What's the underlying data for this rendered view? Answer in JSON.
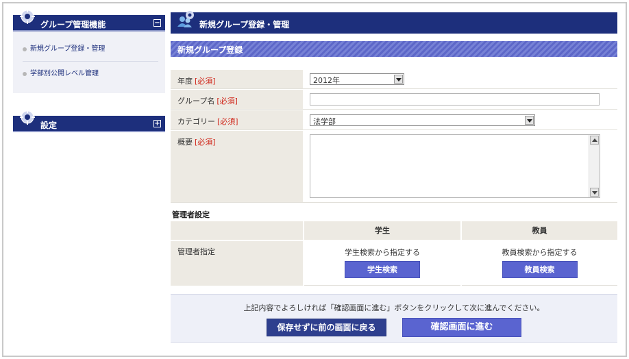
{
  "sidebar": {
    "sections": [
      {
        "title": "グループ管理機能",
        "toggle": "⊟",
        "items": [
          {
            "label": "新規グループ登録・管理"
          },
          {
            "label": "学部別公開レベル管理"
          }
        ]
      },
      {
        "title": "設定",
        "toggle": "⊞"
      }
    ]
  },
  "main": {
    "header": {
      "title": "新規グループ登録・管理"
    },
    "subheader": {
      "title": "新規グループ登録"
    },
    "form": {
      "required_mark": "[必須]",
      "year": {
        "label": "年度",
        "value": "2012年"
      },
      "group_name": {
        "label": "グループ名",
        "value": ""
      },
      "category": {
        "label": "カテゴリー",
        "value": "法学部"
      },
      "summary": {
        "label": "概要",
        "value": ""
      }
    },
    "admin": {
      "section_title": "管理者設定",
      "columns": [
        "学生",
        "教員"
      ],
      "row_label": "管理者指定",
      "student": {
        "hint": "学生検索から指定する",
        "button": "学生検索"
      },
      "teacher": {
        "hint": "教員検索から指定する",
        "button": "教員検索"
      }
    },
    "footer": {
      "message": "上記内容でよろしければ「確認画面に進む」ボタンをクリックして次に進んでください。",
      "back_button": "保存せずに前の画面に戻る",
      "next_button": "確認画面に進む"
    }
  },
  "colors": {
    "navy": "#1d2f7c",
    "accent": "#5a64d0",
    "required": "#d0281c",
    "label_bg": "#edeae3"
  }
}
